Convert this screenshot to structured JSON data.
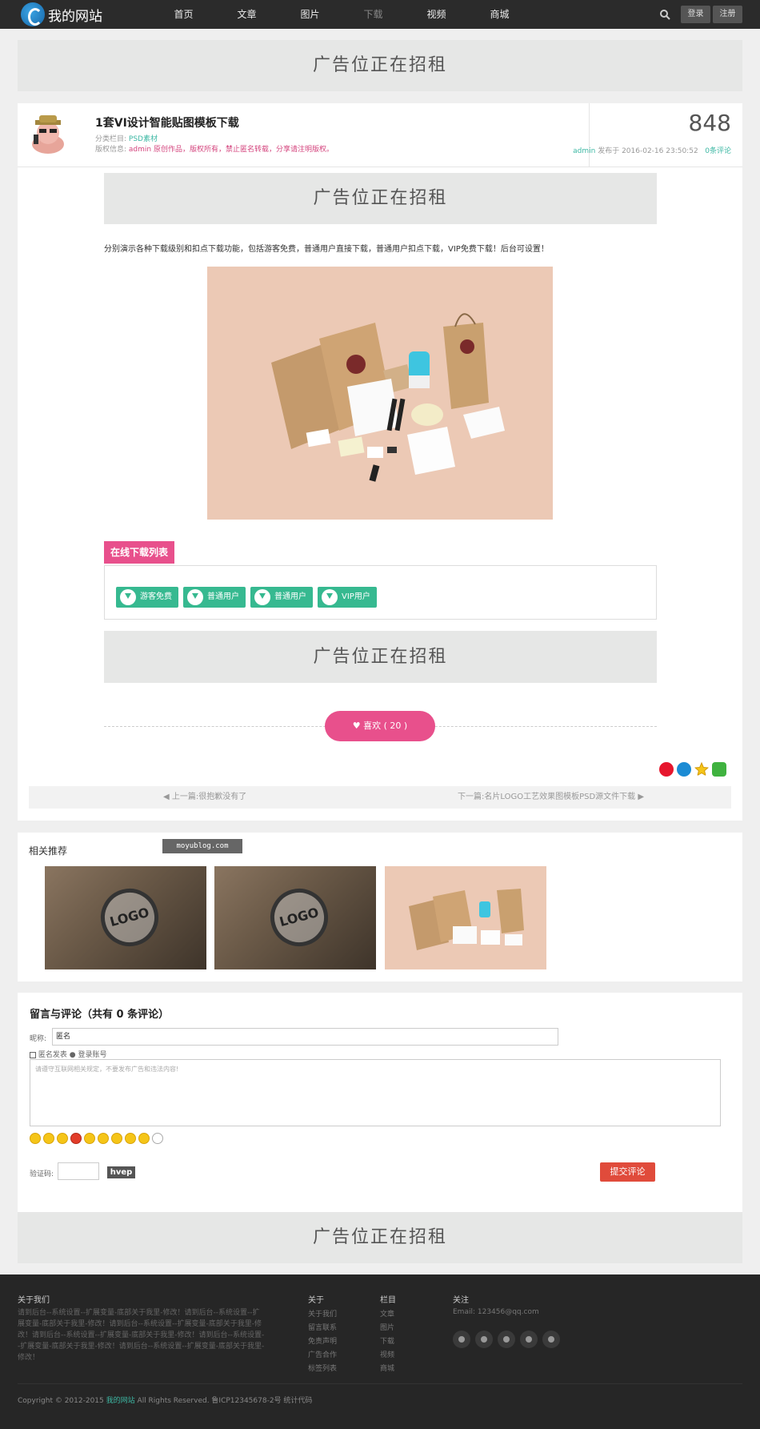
{
  "header": {
    "site_name": "我的网站",
    "nav": [
      "首页",
      "文章",
      "图片",
      "下载",
      "视频",
      "商城"
    ],
    "active_nav": "下载",
    "login": "登录",
    "register": "注册"
  },
  "ad_text": "广告位正在招租",
  "post": {
    "title": "1套VI设计智能贴图模板下载",
    "category_label": "分类栏目:",
    "category": "PSD素材",
    "copyright_label": "版权信息:",
    "copyright": "admin 原创作品，版权所有，禁止匿名转载，分享请注明版权。",
    "views": "848",
    "author": "admin",
    "published": "发布于 2016-02-16 23:50:52",
    "comments": "0条评论",
    "intro": "分别演示各种下载级别和扣点下载功能，包括游客免费，普通用户直接下载，普通用户扣点下载，VIP免费下载！后台可设置！"
  },
  "downloads": {
    "title": "在线下载列表",
    "buttons": [
      "游客免费",
      "普通用户",
      "普通用户",
      "VIP用户"
    ]
  },
  "like": {
    "label": "喜欢 ( 20 )"
  },
  "nav_links": {
    "prev": "上一篇:很抱歉没有了",
    "next": "下一篇:名片LOGO工艺效果图模板PSD源文件下载"
  },
  "related": {
    "title": "相关推荐",
    "watermark": "moyublog.com",
    "stamp_text": "LOGO"
  },
  "comment": {
    "title": "留言与评论（共有 0 条评论）",
    "nickname_label": "昵称:",
    "nickname_value": "匿名",
    "anon_label": "匿名发表",
    "login_label": "登录账号",
    "placeholder": "请遵守互联网相关规定，不要发布广告和违法内容!",
    "captcha_label": "验证码:",
    "captcha_text": "hvep",
    "submit": "提交评论"
  },
  "footer": {
    "about_title": "关于我们",
    "about_text": "请到后台--系统设置--扩展变量-底部关于我里-修改！请到后台--系统设置--扩展变量-底部关于我里-修改！请到后台--系统设置--扩展变量-底部关于我里-修改！请到后台--系统设置--扩展变量-底部关于我里-修改！请到后台--系统设置--扩展变量-底部关于我里-修改！请到后台--系统设置--扩展变量-底部关于我里-修改！",
    "col1_title": "关于",
    "col1_links": [
      "关于我们",
      "留言联系",
      "免责声明",
      "广告合作",
      "标签列表"
    ],
    "col2_title": "栏目",
    "col2_links": [
      "文章",
      "图片",
      "下载",
      "视频",
      "商城"
    ],
    "col3_title": "关注",
    "email": "Email: 123456@qq.com",
    "copyright_pre": "Copyright © 2012-2015",
    "copyright_site": "我的网站",
    "copyright_post": "All Rights Reserved. 鲁ICP12345678-2号 统计代码"
  },
  "colors": {
    "accent": "#e8508c",
    "teal": "#36b990",
    "submit": "#e04b3b"
  }
}
